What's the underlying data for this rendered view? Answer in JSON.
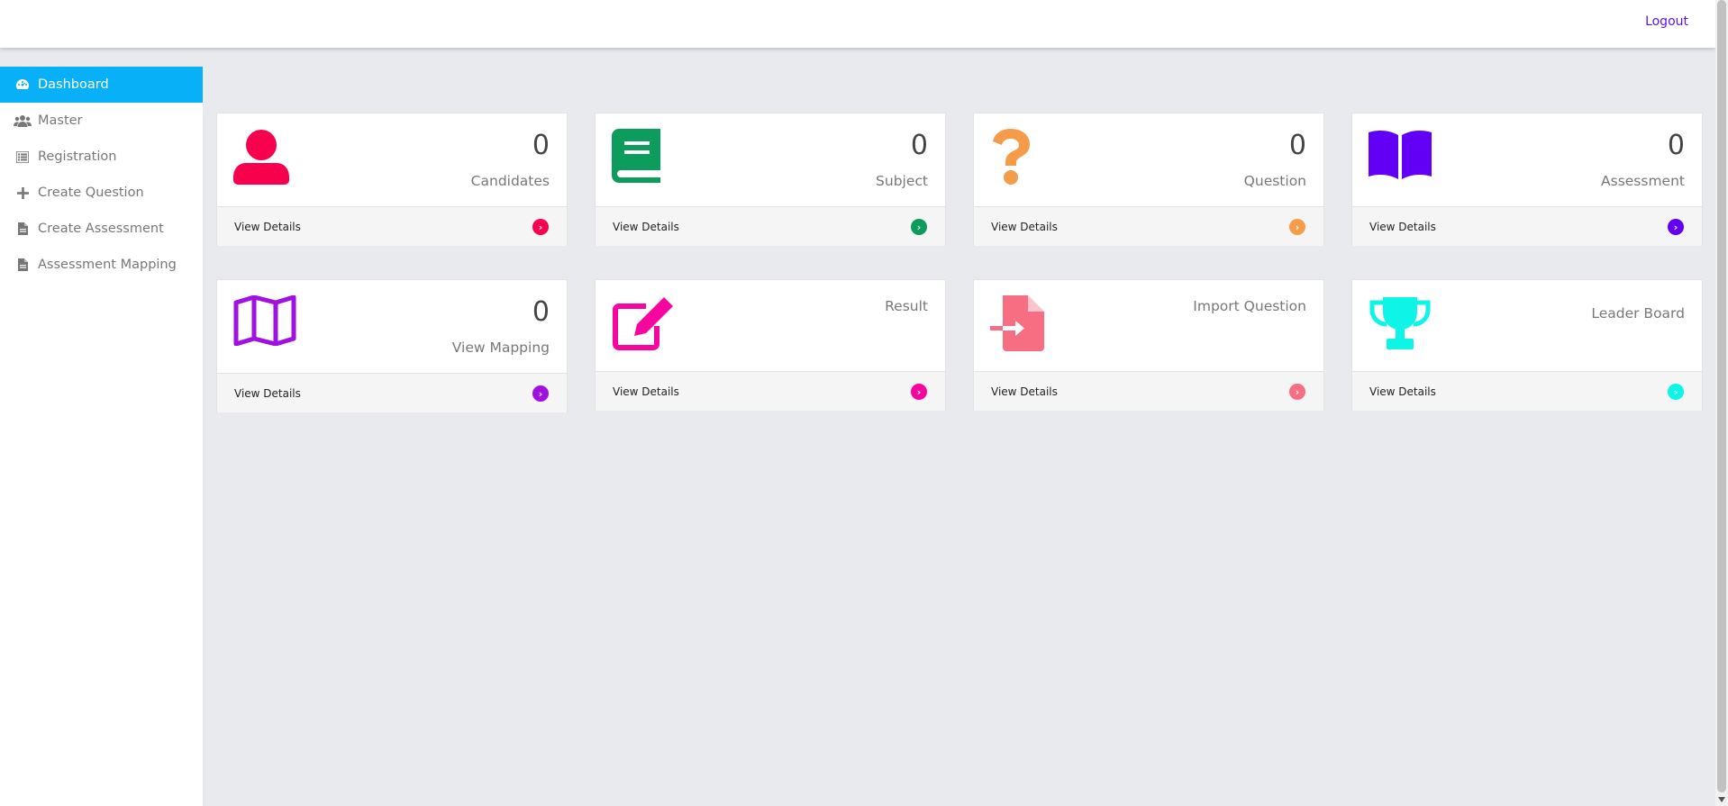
{
  "header": {
    "logout_label": "Logout"
  },
  "sidebar": {
    "items": [
      {
        "label": "Dashboard",
        "icon": "dashboard-icon",
        "active": true
      },
      {
        "label": "Master",
        "icon": "users-icon"
      },
      {
        "label": "Registration",
        "icon": "list-icon"
      },
      {
        "label": "Create Question",
        "icon": "plus-icon"
      },
      {
        "label": "Create Assessment",
        "icon": "file-icon"
      },
      {
        "label": "Assessment Mapping",
        "icon": "file-icon"
      }
    ]
  },
  "cards": [
    {
      "count": "0",
      "label": "Candidates",
      "link": "View Details",
      "icon": "user-icon",
      "color": "#f7014e"
    },
    {
      "count": "0",
      "label": "Subject",
      "link": "View Details",
      "icon": "book-icon",
      "color": "#0c9c5b"
    },
    {
      "count": "0",
      "label": "Question",
      "link": "View Details",
      "icon": "question-icon",
      "color": "#f59c4b"
    },
    {
      "count": "0",
      "label": "Assessment",
      "link": "View Details",
      "icon": "open-book-icon",
      "color": "#6200f5"
    },
    {
      "count": "0",
      "label": "View Mapping",
      "link": "View Details",
      "icon": "map-icon",
      "color": "#a011e1"
    },
    {
      "label": "Result",
      "link": "View Details",
      "icon": "edit-icon",
      "color": "#f7059f"
    },
    {
      "label": "Import Question",
      "link": "View Details",
      "icon": "file-import-icon",
      "color": "#f76e82"
    },
    {
      "label": "Leader Board",
      "link": "View Details",
      "icon": "trophy-icon",
      "color": "#0ef5e8"
    }
  ]
}
